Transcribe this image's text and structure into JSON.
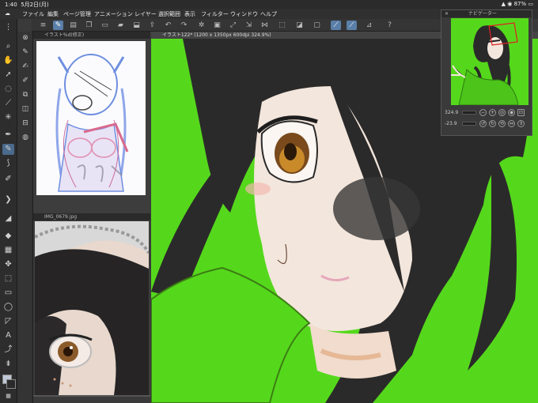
{
  "status": {
    "time": "1:40",
    "date": "5月2日(月)",
    "battery": "87%"
  },
  "menu": [
    "ファイル",
    "編集",
    "ページ管理",
    "アニメーション",
    "レイヤー",
    "選択範囲",
    "表示",
    "フィルター",
    "ウィンドウ",
    "ヘルプ"
  ],
  "panels": {
    "ref1_title": "イラスト%d(修正)",
    "ref2_title": "IMG_0679.jpg",
    "canvas_title": "イラスト122* (1200 x 1350px 600dpi 324.9%)",
    "navigator_title": "ナビゲーター"
  },
  "navigator": {
    "zoom": "324.9",
    "rotation": "-23.9"
  },
  "icons": {
    "menu": "hamburger-icon",
    "undo": "undo-icon",
    "redo": "redo-icon",
    "help": "help-icon"
  },
  "colors": {
    "canvas_bg": "#55d81c",
    "hair": "#2b2a2a",
    "skin": "#f3e6dc",
    "accent": "#5a7fa8"
  }
}
